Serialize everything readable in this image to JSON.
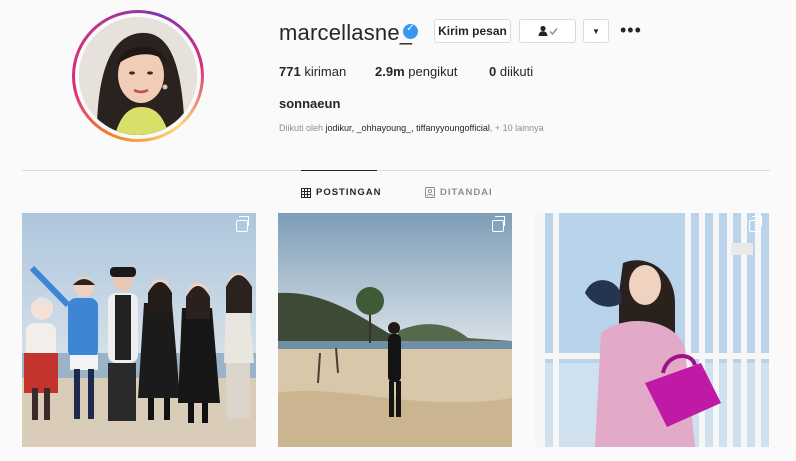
{
  "profile": {
    "username": "marcellasne_",
    "full_name": "sonnaeun",
    "verified": true
  },
  "actions": {
    "message_label": "Kirim pesan",
    "following_icon": "person-check-icon",
    "dropdown_icon": "chevron-down-icon",
    "more_icon": "more-horizontal-icon"
  },
  "stats": {
    "posts_count": "771",
    "posts_label": "kiriman",
    "followers_count": "2.9m",
    "followers_label": "pengikut",
    "following_count": "0",
    "following_label": "diikuti"
  },
  "followed_by": {
    "prefix": "Diikuti oleh",
    "names": "jodikur, _ohhayoung_, tiffanyyoungofficial",
    "more": ", + 10 lainnya"
  },
  "tabs": [
    {
      "label": "POSTINGAN",
      "icon": "grid-icon",
      "active": true
    },
    {
      "label": "DITANDAI",
      "icon": "tagged-icon",
      "active": false
    }
  ],
  "posts": [
    {
      "type": "carousel"
    },
    {
      "type": "carousel"
    },
    {
      "type": "carousel"
    }
  ],
  "colors": {
    "verified": "#3897f0",
    "text": "#262626",
    "muted": "#8e8e8e",
    "border": "#dbdbdb"
  }
}
